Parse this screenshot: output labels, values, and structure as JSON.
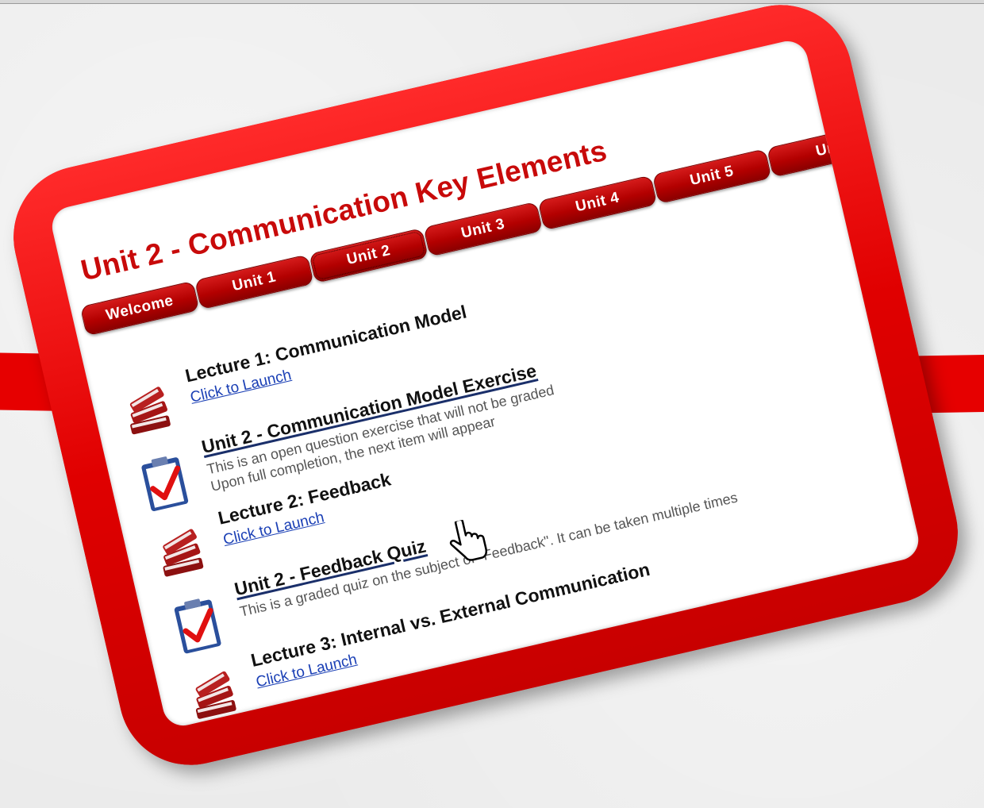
{
  "page": {
    "title": "Unit 2 - Communication Key Elements"
  },
  "tabs": [
    {
      "label": "Welcome"
    },
    {
      "label": "Unit 1"
    },
    {
      "label": "Unit 2"
    },
    {
      "label": "Unit 3"
    },
    {
      "label": "Unit 4"
    },
    {
      "label": "Unit 5"
    },
    {
      "label": "Un"
    }
  ],
  "items": [
    {
      "type": "lecture",
      "icon": "books-icon",
      "title": "Lecture 1: Communication Model",
      "link": "Click to Launch"
    },
    {
      "type": "exercise",
      "icon": "clipboard-check-icon",
      "title": "Unit 2 - Communication Model Exercise",
      "desc_line1": "This is an open question exercise that will not be graded",
      "desc_line2": "Upon full completion, the next item will appear"
    },
    {
      "type": "lecture",
      "icon": "books-icon",
      "title": "Lecture 2: Feedback",
      "link": "Click to Launch"
    },
    {
      "type": "quiz",
      "icon": "clipboard-check-icon",
      "title": "Unit 2 - Feedback Quiz",
      "desc_line1": "This is a graded quiz on the subject of \"Feedback\". It can be taken multiple times"
    },
    {
      "type": "lecture",
      "icon": "books-icon",
      "title": "Lecture 3: Internal vs. External Communication",
      "link": "Click to Launch"
    }
  ],
  "colors": {
    "frame_red": "#ee0000",
    "title_red": "#c80a0a",
    "tab_red": "#b30000",
    "link_blue": "#1a3fb5"
  }
}
